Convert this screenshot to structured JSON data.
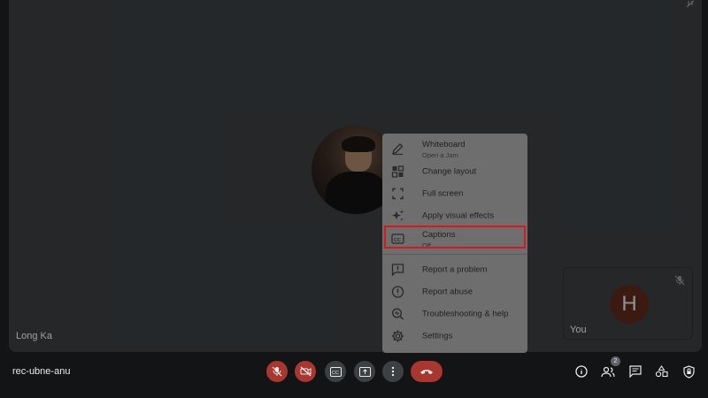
{
  "participants": {
    "main": {
      "name": "Long Ka"
    },
    "self": {
      "initial": "H",
      "label": "You"
    }
  },
  "menu": {
    "items": [
      {
        "label": "Whiteboard",
        "sub": "Open a Jam",
        "icon": "pencil-icon"
      },
      {
        "label": "Change layout",
        "icon": "layout-icon"
      },
      {
        "label": "Full screen",
        "icon": "fullscreen-icon"
      },
      {
        "label": "Apply visual effects",
        "icon": "sparkle-icon"
      },
      {
        "label": "Captions",
        "sub": "Off",
        "icon": "captions-icon"
      },
      {
        "label": "Report a problem",
        "icon": "report-problem-icon"
      },
      {
        "label": "Report abuse",
        "icon": "report-abuse-icon"
      },
      {
        "label": "Troubleshooting & help",
        "icon": "troubleshoot-icon"
      },
      {
        "label": "Settings",
        "icon": "gear-icon"
      }
    ],
    "highlight_color": "#d8181f"
  },
  "bottombar": {
    "meeting_code": "rec-ubne-anu",
    "participant_count": "2"
  },
  "colors": {
    "background": "#202124",
    "tile": "#3c4043",
    "danger": "#a8382f"
  }
}
